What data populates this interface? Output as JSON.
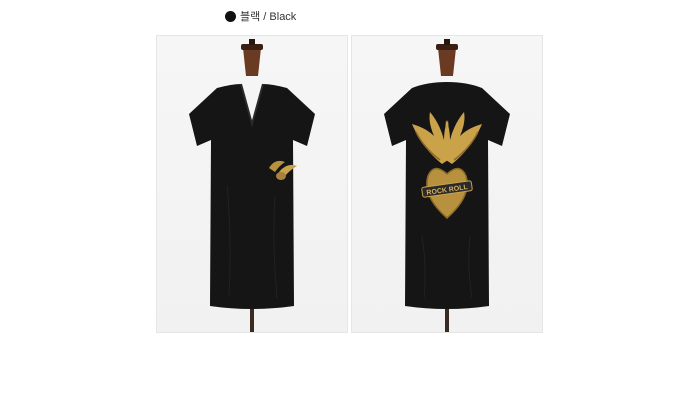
{
  "color_option": {
    "swatch_color": "#111111",
    "label": "블랙 / Black"
  },
  "photos": [
    {
      "view": "front",
      "description_icon": "front-tshirt"
    },
    {
      "view": "back",
      "description_icon": "back-tshirt"
    }
  ],
  "graphic": {
    "back_print_text": "ROCK ROLL"
  },
  "colors": {
    "shirt": "#151515",
    "gold": "#c9a24a",
    "mannequin": "#6b3a22",
    "background": "#f3f3f3"
  }
}
